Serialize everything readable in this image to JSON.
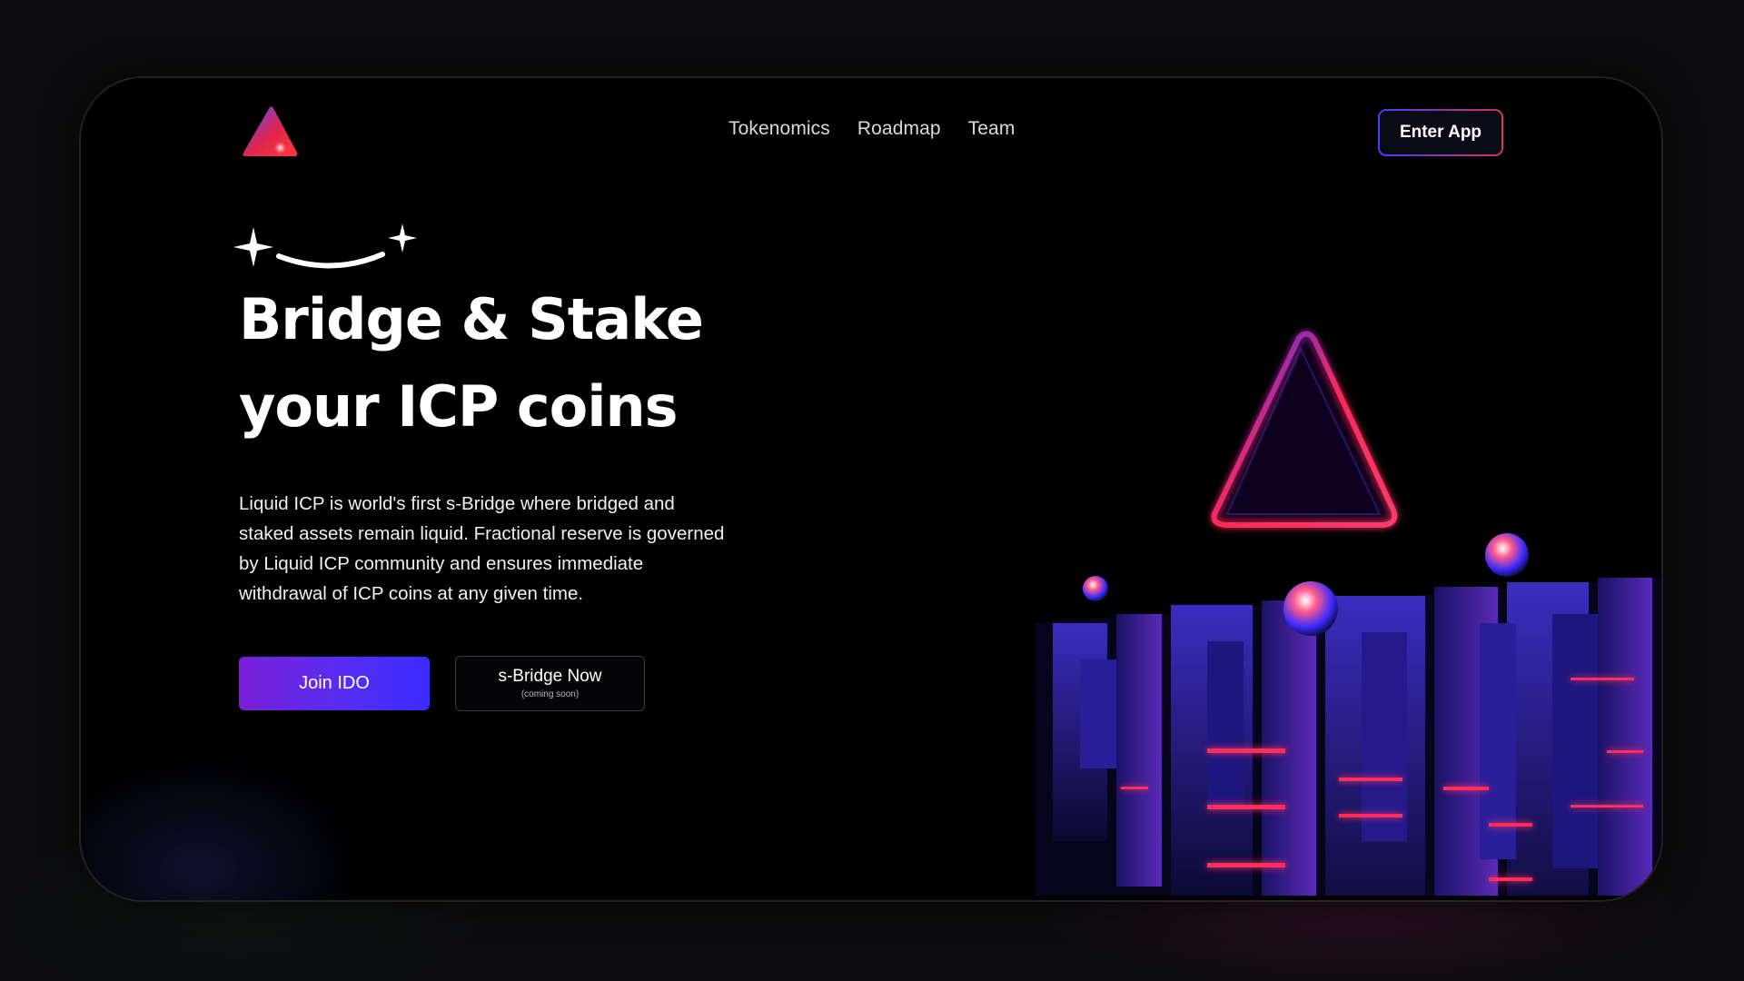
{
  "header": {
    "logo": "liquid-icp-logo",
    "nav": [
      {
        "label": "Tokenomics"
      },
      {
        "label": "Roadmap"
      },
      {
        "label": "Team"
      }
    ],
    "enter_app_label": "Enter App"
  },
  "hero": {
    "title_line1": "Bridge & Stake",
    "title_line2": "your ICP coins",
    "description": "Liquid ICP is world's first s-Bridge where bridged and staked assets remain liquid. Fractional reserve is governed by Liquid ICP community and ensures immediate withdrawal of ICP coins at any given time.",
    "join_label": "Join IDO",
    "bridge_label": "s-Bridge Now",
    "bridge_sub": "(coming soon)"
  },
  "colors": {
    "background": "#0c0c0e",
    "frame": "#000000",
    "accent_purple": "#5a2cf0",
    "accent_red": "#d6305e",
    "neon_blue": "#3b2cff"
  }
}
